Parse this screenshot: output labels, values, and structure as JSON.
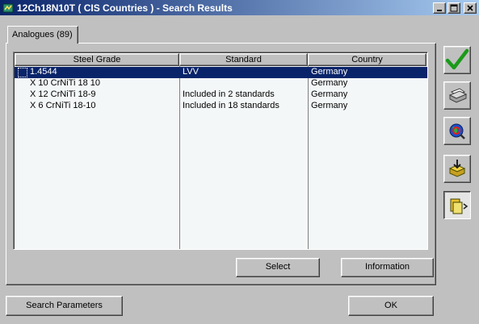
{
  "window": {
    "title": "12Ch18N10T ( CIS Countries ) - Search Results",
    "icon": "app-icon",
    "minimize_icon": "minimize-icon",
    "maximize_icon": "maximize-icon",
    "close_icon": "close-icon"
  },
  "tab": {
    "label": "Analogues (89)"
  },
  "table": {
    "columns": [
      "Steel Grade",
      "Standard",
      "Country"
    ],
    "rows": [
      {
        "grade": "1.4544",
        "standard": "LVV",
        "country": "Germany",
        "selected": true
      },
      {
        "grade": "X 10 CrNiTi 18 10",
        "standard": "",
        "country": "Germany",
        "selected": false
      },
      {
        "grade": "X 12 CrNiTi 18-9",
        "standard": "Included in 2 standards",
        "country": "Germany",
        "selected": false
      },
      {
        "grade": "X 6 CrNiTi 18-10",
        "standard": "Included in 18 standards",
        "country": "Germany",
        "selected": false
      }
    ]
  },
  "buttons": {
    "select": "Select",
    "information": "Information",
    "search_parameters": "Search Parameters",
    "ok": "OK"
  },
  "toolbar": {
    "items": [
      {
        "icon": "checkmark-icon"
      },
      {
        "icon": "printer-icon"
      },
      {
        "icon": "globe-search-icon"
      },
      {
        "icon": "export-icon"
      },
      {
        "icon": "clipboard-icon"
      }
    ]
  },
  "colors": {
    "title_bar_start": "#0a246a",
    "title_bar_end": "#a6caf0",
    "selection": "#0a246a",
    "list_background": "#f4f7f8",
    "check_green": "#1a9a1a"
  }
}
